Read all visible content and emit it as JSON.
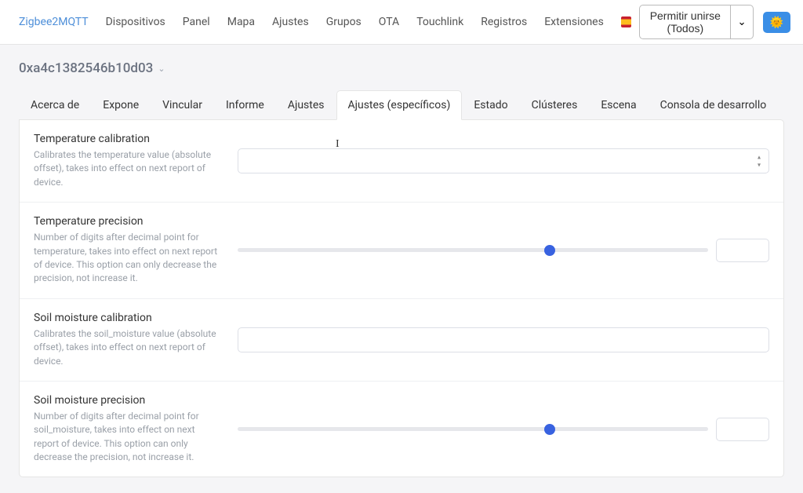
{
  "nav": {
    "brand": "Zigbee2MQTT",
    "items": [
      "Dispositivos",
      "Panel",
      "Mapa",
      "Ajustes",
      "Grupos",
      "OTA",
      "Touchlink",
      "Registros",
      "Extensiones"
    ],
    "permit_label": "Permitir unirse (Todos)",
    "caret": "⌄",
    "theme_emoji": "🌞"
  },
  "device": {
    "id": "0xa4c1382546b10d03"
  },
  "tabs": {
    "items": [
      "Acerca de",
      "Expone",
      "Vincular",
      "Informe",
      "Ajustes",
      "Ajustes (específicos)",
      "Estado",
      "Clústeres",
      "Escena",
      "Consola de desarrollo"
    ],
    "active_index": 5
  },
  "settings": [
    {
      "title": "Temperature calibration",
      "desc": "Calibrates the temperature value (absolute offset), takes into effect on next report of device.",
      "control": "number",
      "value": ""
    },
    {
      "title": "Temperature precision",
      "desc": "Number of digits after decimal point for temperature, takes into effect on next report of device. This option can only decrease the precision, not increase it.",
      "control": "range",
      "value": ""
    },
    {
      "title": "Soil moisture calibration",
      "desc": "Calibrates the soil_moisture value (absolute offset), takes into effect on next report of device.",
      "control": "number_plain",
      "value": ""
    },
    {
      "title": "Soil moisture precision",
      "desc": "Number of digits after decimal point for soil_moisture, takes into effect on next report of device. This option can only decrease the precision, not increase it.",
      "control": "range",
      "value": ""
    }
  ]
}
